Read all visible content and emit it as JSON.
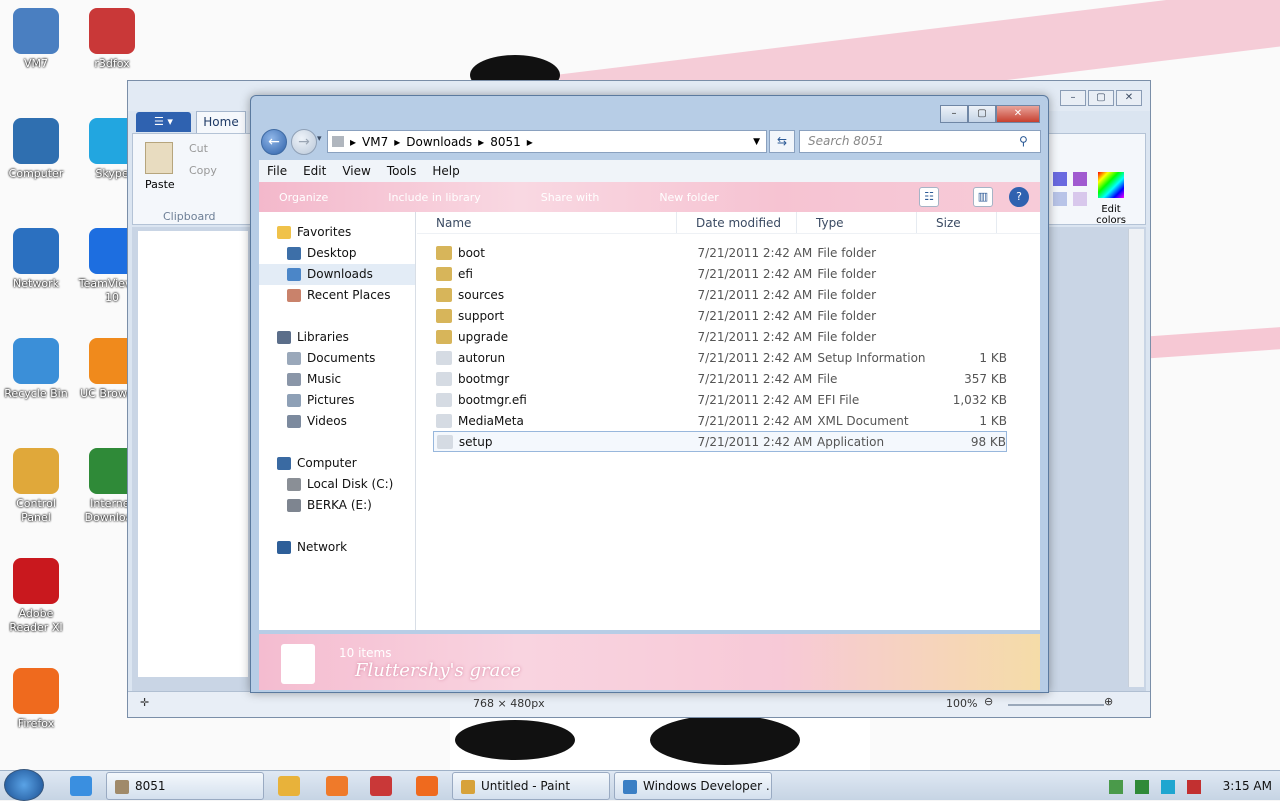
{
  "desktop": {
    "icons": [
      {
        "label": "VM7",
        "color": "#4a7fc1"
      },
      {
        "label": "r3dfox",
        "color": "#c93838"
      },
      {
        "label": "Computer",
        "color": "#2f6fb0"
      },
      {
        "label": "Skype",
        "color": "#22a6e0"
      },
      {
        "label": "Network",
        "color": "#2b70c0"
      },
      {
        "label": "TeamViewer 10",
        "color": "#1d6ee0"
      },
      {
        "label": "Recycle Bin",
        "color": "#3b8fd8"
      },
      {
        "label": "UC Browser",
        "color": "#f08a1c"
      },
      {
        "label": "Control Panel",
        "color": "#e0a83a"
      },
      {
        "label": "Internet Download",
        "color": "#2f8a38"
      },
      {
        "label": "Adobe Reader XI",
        "color": "#c9181e"
      },
      {
        "label": "Firefox",
        "color": "#ef6a1e"
      }
    ]
  },
  "paint": {
    "menu_icon": "paint-menu-icon",
    "home_tab": "Home",
    "paste": "Paste",
    "cut": "Cut",
    "copy": "Copy",
    "clipboard": "Clipboard",
    "edit_colors": "Edit colors",
    "dimensions": "768 × 480px",
    "zoom": "100%"
  },
  "explorer": {
    "breadcrumb": [
      "VM7",
      "Downloads",
      "8051"
    ],
    "search_placeholder": "Search 8051",
    "menus": [
      "File",
      "Edit",
      "View",
      "Tools",
      "Help"
    ],
    "toolbar": [
      "Organize",
      "Include in library",
      "Share with",
      "New folder"
    ],
    "columns": {
      "name": "Name",
      "date": "Date modified",
      "type": "Type",
      "size": "Size"
    },
    "nav": {
      "favorites": "Favorites",
      "desktop": "Desktop",
      "downloads": "Downloads",
      "recent": "Recent Places",
      "libraries": "Libraries",
      "documents": "Documents",
      "music": "Music",
      "pictures": "Pictures",
      "videos": "Videos",
      "computer": "Computer",
      "local_disk": "Local Disk (C:)",
      "berka": "BERKA (E:)",
      "network": "Network"
    },
    "files": [
      {
        "name": "boot",
        "date": "7/21/2011 2:42 AM",
        "type": "File folder",
        "size": ""
      },
      {
        "name": "efi",
        "date": "7/21/2011 2:42 AM",
        "type": "File folder",
        "size": ""
      },
      {
        "name": "sources",
        "date": "7/21/2011 2:42 AM",
        "type": "File folder",
        "size": ""
      },
      {
        "name": "support",
        "date": "7/21/2011 2:42 AM",
        "type": "File folder",
        "size": ""
      },
      {
        "name": "upgrade",
        "date": "7/21/2011 2:42 AM",
        "type": "File folder",
        "size": ""
      },
      {
        "name": "autorun",
        "date": "7/21/2011 2:42 AM",
        "type": "Setup Information",
        "size": "1 KB"
      },
      {
        "name": "bootmgr",
        "date": "7/21/2011 2:42 AM",
        "type": "File",
        "size": "357 KB"
      },
      {
        "name": "bootmgr.efi",
        "date": "7/21/2011 2:42 AM",
        "type": "EFI File",
        "size": "1,032 KB"
      },
      {
        "name": "MediaMeta",
        "date": "7/21/2011 2:42 AM",
        "type": "XML Document",
        "size": "1 KB"
      },
      {
        "name": "setup",
        "date": "7/21/2011 2:42 AM",
        "type": "Application",
        "size": "98 KB"
      }
    ],
    "selected_file": "setup",
    "item_count": "10 items",
    "theme_text": "Fluttershy's grace"
  },
  "taskbar": {
    "tasks": [
      {
        "label": "8051",
        "color": "#a08a6a"
      },
      {
        "label": "Untitled - Paint",
        "color": "#d7a23a"
      },
      {
        "label": "Windows Developer ...",
        "color": "#3b7fc4"
      }
    ],
    "clock": "3:15 AM"
  },
  "colors": {
    "folder": "#d7b55a",
    "file": "#d5dbe3",
    "accent": "#2f62b0"
  }
}
